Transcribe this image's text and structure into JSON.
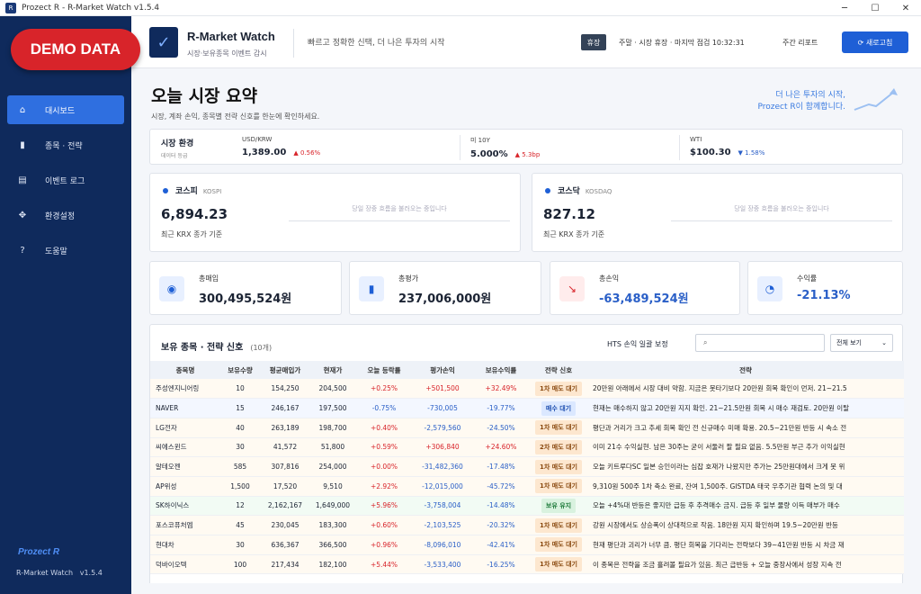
{
  "window": {
    "title": "Prozect R - R-Market Watch v1.5.4"
  },
  "demo_badge": "DEMO DATA",
  "sidebar": {
    "items": [
      {
        "label": "대시보드",
        "icon": "home-icon",
        "active": true
      },
      {
        "label": "종목 · 전략",
        "icon": "bar-chart-icon",
        "active": false
      },
      {
        "label": "이벤트 로그",
        "icon": "log-icon",
        "active": false
      },
      {
        "label": "환경설정",
        "icon": "settings-icon",
        "active": false
      },
      {
        "label": "도움말",
        "icon": "help-icon",
        "active": false
      }
    ],
    "logo_text": "Prozect R",
    "version_label": "R-Market Watch",
    "version": "v1.5.4"
  },
  "header": {
    "app_title": "R-Market Watch",
    "app_subtitle": "시장·보유종목 이벤트 감시",
    "slogan": "빠르고 정확한 신택, 더 나은 투자의 시작",
    "market_badge": "휴장",
    "market_status": "주말 · 시장 휴장 · 마지막 점검 10:32:31",
    "report_label": "주간 리포트",
    "refresh_label": "새로고침"
  },
  "page": {
    "title": "오늘 시장 요약",
    "subtitle": "시장, 계좌 손익, 종목별 전략 신호를 한눈에 확인하세요.",
    "promo_line1": "더 나은 투자의 시작,",
    "promo_line2": "Prozect R이 함께합니다."
  },
  "market_env": {
    "label": "시장 환경",
    "sublabel": "데이터 등급",
    "items": [
      {
        "name": "USD/KRW",
        "value": "1,389.00",
        "change": "▲ 0.56%",
        "dir": "up"
      },
      {
        "name": "미 10Y",
        "value": "5.000%",
        "change": "▲ 5.3bp",
        "dir": "up"
      },
      {
        "name": "WTI",
        "value": "$100.30",
        "change": "▼ 1.58%",
        "dir": "down"
      }
    ]
  },
  "indices": [
    {
      "name": "코스피",
      "en": "KOSPI",
      "value": "6,894.23",
      "base": "최근 KRX 종가 기준",
      "loading": "당일 장중 흐름을 불러오는 중입니다"
    },
    {
      "name": "코스닥",
      "en": "KOSDAQ",
      "value": "827.12",
      "base": "최근 KRX 종가 기준",
      "loading": "당일 장중 흐름을 불러오는 중입니다"
    }
  ],
  "stats": [
    {
      "label": "총매입",
      "value": "300,495,524원",
      "icon": "database-icon"
    },
    {
      "label": "총평가",
      "value": "237,006,000원",
      "icon": "bar-chart-icon"
    },
    {
      "label": "총손익",
      "value": "-63,489,524원",
      "icon": "trend-down-icon"
    },
    {
      "label": "수익률",
      "value": "-21.13%",
      "icon": "pie-chart-icon"
    }
  ],
  "holdings": {
    "title": "보유 종목 · 전략 신호",
    "count": "(10개)",
    "hts_label": "HTS 손익 일괄 보정",
    "search_placeholder": "⌕",
    "filter_label": "전체 보기",
    "columns": [
      "종목명",
      "보유수량",
      "평균매입가",
      "현재가",
      "오늘 등락률",
      "평가손익",
      "보유수익률",
      "전략 신호",
      "전략"
    ],
    "rows": [
      {
        "name": "주성엔지니어링",
        "qty": "10",
        "avg": "154,250",
        "cur": "204,500",
        "day": "+0.25%",
        "pl": "+501,500",
        "ret": "+32.49%",
        "signal": "1차 매도 대기",
        "kind": "sell",
        "memo": "20만원 아래에서 시장 대비 약함. 지금은 못타기보다 20만원 회복 확인이 먼저. 21~21.5"
      },
      {
        "name": "NAVER",
        "qty": "15",
        "avg": "246,167",
        "cur": "197,500",
        "day": "-0.75%",
        "pl": "-730,005",
        "ret": "-19.77%",
        "signal": "매수 대기",
        "kind": "buy",
        "memo": "현재는 매수하지 않고 20만원 지지 확인. 21~21.5만원 회복 시 매수 재검토. 20만원 이탈"
      },
      {
        "name": "LG전자",
        "qty": "40",
        "avg": "263,189",
        "cur": "198,700",
        "day": "+0.40%",
        "pl": "-2,579,560",
        "ret": "-24.50%",
        "signal": "1차 매도 대기",
        "kind": "sell",
        "memo": "평단과 거리가 크고 추세 회복 확인 전 신규매수 미매 확용. 20.5~21만원 반등 시 속소 전"
      },
      {
        "name": "씨에스윈드",
        "qty": "30",
        "avg": "41,572",
        "cur": "51,800",
        "day": "+0.59%",
        "pl": "+306,840",
        "ret": "+24.60%",
        "signal": "2차 매도 대기",
        "kind": "sell",
        "memo": "이미 21수 수익실현. 남은 30주는 굳이 서둘러 팔 필요 없음. 5.5만원 부근 추가 이익실현"
      },
      {
        "name": "알테오젠",
        "qty": "585",
        "avg": "307,816",
        "cur": "254,000",
        "day": "+0.00%",
        "pl": "-31,482,360",
        "ret": "-17.48%",
        "signal": "1차 매도 대기",
        "kind": "sell",
        "memo": "오늘 키트루다SC 일본 승인이라는 심잡 호재가 나왔지만 주가는 25만원대에서 크게 못 위"
      },
      {
        "name": "AP위성",
        "qty": "1,500",
        "avg": "17,520",
        "cur": "9,510",
        "day": "+2.92%",
        "pl": "-12,015,000",
        "ret": "-45.72%",
        "signal": "1차 매도 대기",
        "kind": "sell",
        "memo": "9,310원 500주 1차 축소 완료, 잔여 1,500주. GISTDA 태국 우주기관 협력 논의 및 대"
      },
      {
        "name": "SK하이닉스",
        "qty": "12",
        "avg": "2,162,167",
        "cur": "1,649,000",
        "day": "+5.96%",
        "pl": "-3,758,004",
        "ret": "-14.48%",
        "signal": "보유 유지",
        "kind": "hold",
        "memo": "오늘 +4%대 반등은 좋지만 급등 후 추격매수 금지. 급등 후 일부 물량 이득 매부가 매수"
      },
      {
        "name": "포스코퓨처엠",
        "qty": "45",
        "avg": "230,045",
        "cur": "183,300",
        "day": "+0.60%",
        "pl": "-2,103,525",
        "ret": "-20.32%",
        "signal": "1차 매도 대기",
        "kind": "sell",
        "memo": "강원 시장에서도 상승폭이 상대적으로 작음. 18만원 지지 확인하며 19.5~20만원 반등"
      },
      {
        "name": "현대차",
        "qty": "30",
        "avg": "636,367",
        "cur": "366,500",
        "day": "+0.96%",
        "pl": "-8,096,010",
        "ret": "-42.41%",
        "signal": "1차 매도 대기",
        "kind": "sell",
        "memo": "현재 평단과 괴리가 너무 큼. 평단 회복을 기다리는 전략보다 39~41만원 반등 시 차금 재"
      },
      {
        "name": "덕바이오텍",
        "qty": "100",
        "avg": "217,434",
        "cur": "182,100",
        "day": "+5.44%",
        "pl": "-3,533,400",
        "ret": "-16.25%",
        "signal": "1차 매도 대기",
        "kind": "sell",
        "memo": "이 종목은 전략을 조금 흘려볼 필요가 있음. 최근 급반등 + 오늘 중장사에서 성장 지속 전"
      }
    ]
  },
  "colors": {
    "sidebar": "#0f2a5c",
    "accent": "#1e5fd6",
    "up": "#d8242a",
    "down": "#2a5fc7",
    "demo": "#d8242a"
  }
}
